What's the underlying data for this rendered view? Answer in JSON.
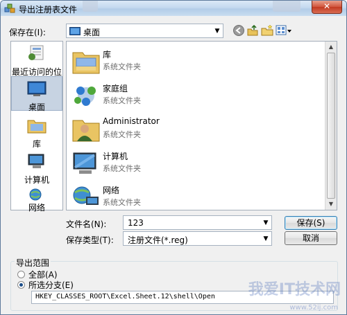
{
  "window": {
    "title": "导出注册表文件",
    "close_glyph": "✕"
  },
  "look_in": {
    "label": "保存在(I):",
    "value": "桌面"
  },
  "places": [
    {
      "label": "最近访问的位置",
      "icon": "recent-places-icon",
      "selected": false
    },
    {
      "label": "桌面",
      "icon": "desktop-icon",
      "selected": true
    },
    {
      "label": "库",
      "icon": "library-icon",
      "selected": false
    },
    {
      "label": "计算机",
      "icon": "computer-icon",
      "selected": false
    },
    {
      "label": "网络",
      "icon": "network-icon",
      "selected": false
    }
  ],
  "files": [
    {
      "name": "库",
      "type": "系统文件夹",
      "icon": "library-icon"
    },
    {
      "name": "家庭组",
      "type": "系统文件夹",
      "icon": "homegroup-icon"
    },
    {
      "name": "Administrator",
      "type": "系统文件夹",
      "icon": "user-folder-icon"
    },
    {
      "name": "计算机",
      "type": "系统文件夹",
      "icon": "computer-icon"
    },
    {
      "name": "网络",
      "type": "系统文件夹",
      "icon": "network-icon"
    }
  ],
  "filename": {
    "label": "文件名(N):",
    "value": "123"
  },
  "filetype": {
    "label": "保存类型(T):",
    "value": "注册文件(*.reg)"
  },
  "buttons": {
    "save": "保存(S)",
    "cancel": "取消"
  },
  "export_range": {
    "title": "导出范围",
    "all_label": "全部(A)",
    "branch_label": "所选分支(E)",
    "branch_value": "HKEY_CLASSES_ROOT\\Excel.Sheet.12\\shell\\Open",
    "selected": "branch"
  },
  "watermark": {
    "text": "我爱IT技术网",
    "url": "www.52ij.com"
  },
  "colors": {
    "selection": "#c7d3e2",
    "title_bar": "#c4d9ef"
  }
}
